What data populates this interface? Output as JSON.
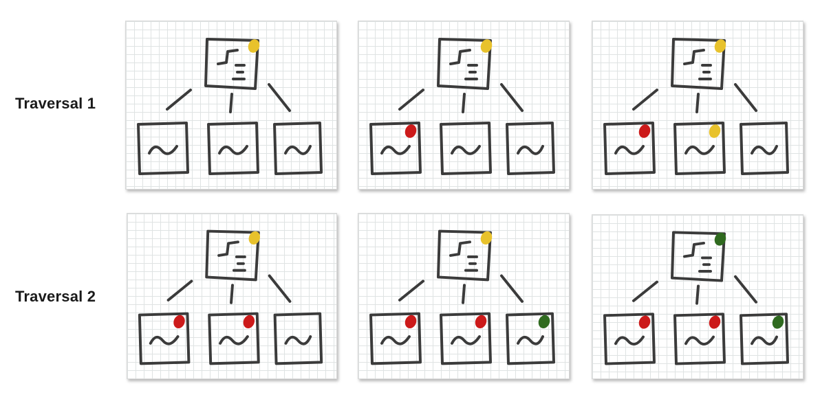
{
  "rows": [
    {
      "label": "Traversal 1",
      "panels": [
        {
          "root": "yellow",
          "children": [
            null,
            null,
            null
          ]
        },
        {
          "root": "yellow",
          "children": [
            "red",
            null,
            null
          ]
        },
        {
          "root": "yellow",
          "children": [
            "red",
            "yellow",
            null
          ]
        }
      ]
    },
    {
      "label": "Traversal 2",
      "panels": [
        {
          "root": "yellow",
          "children": [
            "red",
            "red",
            null
          ]
        },
        {
          "root": "yellow",
          "children": [
            "red",
            "red",
            "green"
          ]
        },
        {
          "root": "green",
          "children": [
            "red",
            "red",
            "green"
          ]
        }
      ]
    }
  ],
  "colors": {
    "yellow": "#e8c22c",
    "red": "#cc1a1a",
    "green": "#2f6a1f",
    "ink": "#3b3b3b"
  }
}
